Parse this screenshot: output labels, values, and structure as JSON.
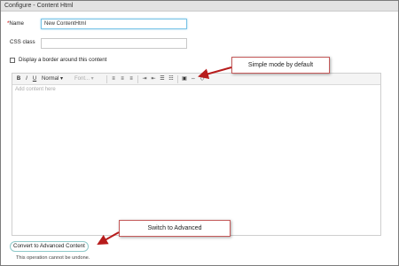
{
  "dialog": {
    "title": "Configure - Content Html"
  },
  "form": {
    "name_label": "Name",
    "required_mark": "*",
    "name_value": "New ContentHtml",
    "css_label": "CSS class",
    "css_value": "",
    "border_label": "Display a border around this content",
    "border_checked": false
  },
  "editor": {
    "placeholder": "Add content here",
    "toolbar": {
      "bold": "B",
      "italic": "I",
      "underline": "U",
      "format": "Normal",
      "font": "Font..."
    }
  },
  "callouts": {
    "simple_mode": "Simple mode by default",
    "switch_advanced": "Switch to Advanced"
  },
  "footer": {
    "convert_button": "Convert to Advanced Content",
    "warning": "This operation cannot be undone."
  },
  "colors": {
    "callout_border": "#c45a5a",
    "arrow": "#b71c1c",
    "focus": "#79c3e6"
  }
}
